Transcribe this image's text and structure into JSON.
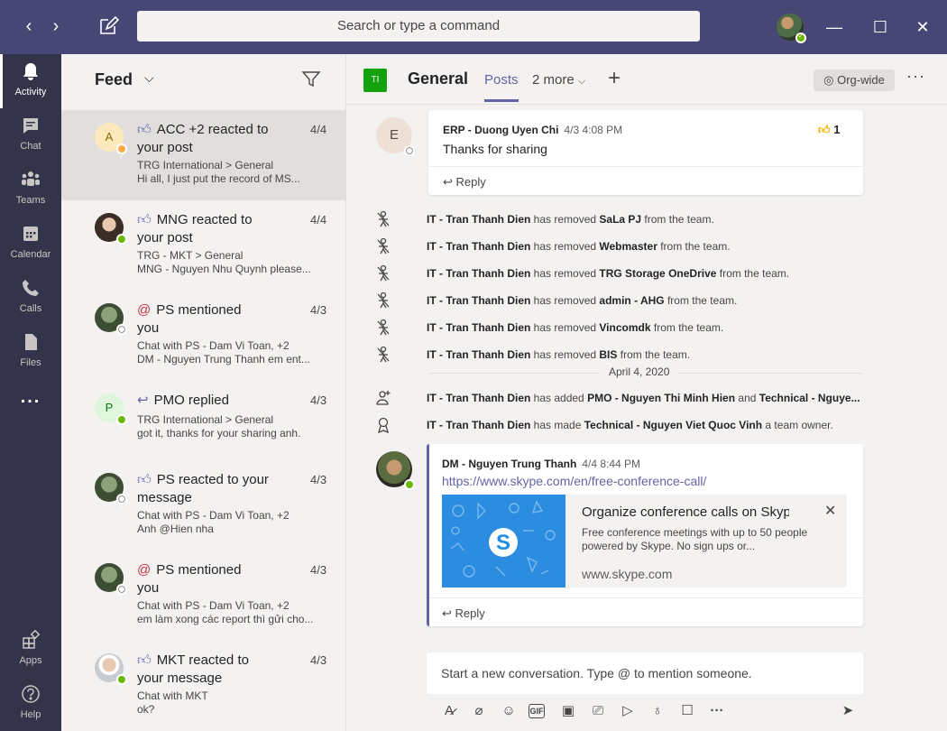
{
  "titlebar": {
    "search_placeholder": "Search or type a command",
    "back": "‹",
    "forward": "›",
    "minimize": "—",
    "maximize": "☐",
    "close": "✕"
  },
  "rail": {
    "items": [
      {
        "label": "Activity",
        "icon": "bell-icon"
      },
      {
        "label": "Chat",
        "icon": "chat-icon"
      },
      {
        "label": "Teams",
        "icon": "teams-icon"
      },
      {
        "label": "Calendar",
        "icon": "calendar-icon"
      },
      {
        "label": "Calls",
        "icon": "phone-icon"
      },
      {
        "label": "Files",
        "icon": "file-icon"
      },
      {
        "label": "...",
        "icon": "more-icon"
      }
    ],
    "apps_label": "Apps",
    "help_label": "Help"
  },
  "feed": {
    "title": "Feed",
    "items": [
      {
        "initial": "A",
        "line1": "ACC +2 reacted to",
        "line1b": "your post",
        "date": "4/4",
        "sub1": "TRG International > General",
        "sub2": "Hi all, I just put the record of MS..."
      },
      {
        "initial": "",
        "line1": "MNG reacted to",
        "line1b": "your post",
        "date": "4/4",
        "sub1": "TRG - MKT > General",
        "sub2": "MNG - Nguyen Nhu Quynh please..."
      },
      {
        "initial": "",
        "line1": "PS mentioned",
        "line1b": "you",
        "date": "4/3",
        "sub1": "Chat with PS - Dam Vi Toan, +2",
        "sub2": "DM - Nguyen Trung Thanh em ent..."
      },
      {
        "initial": "P",
        "line1": "PMO replied",
        "line1b": "",
        "date": "4/3",
        "sub1": "TRG International > General",
        "sub2": "got it, thanks for your sharing anh."
      },
      {
        "initial": "",
        "line1": "PS reacted to your",
        "line1b": "message",
        "date": "4/3",
        "sub1": "Chat with PS - Dam Vi Toan, +2",
        "sub2": "Anh @Hien nha"
      },
      {
        "initial": "",
        "line1": "PS mentioned",
        "line1b": "you",
        "date": "4/3",
        "sub1": "Chat with PS - Dam Vi Toan, +2",
        "sub2": "em làm xong các report thì gửi cho..."
      },
      {
        "initial": "",
        "line1": "MKT reacted to",
        "line1b": "your message",
        "date": "4/3",
        "sub1": "Chat with MKT",
        "sub2": "ok?"
      }
    ]
  },
  "channel": {
    "team_initials": "TI",
    "name": "General",
    "tab_posts": "Posts",
    "tab_more": "2 more",
    "org_wide": "Org-wide"
  },
  "messages": {
    "first": {
      "initial": "E",
      "author": "ERP - Duong Uyen Chi",
      "time": "4/3 4:08 PM",
      "text": "Thanks for sharing",
      "reaction_count": "1",
      "reply": "Reply"
    },
    "system_removed": [
      {
        "actor": "IT - Tran Thanh Dien",
        "verb": " has removed ",
        "target": "SaLa PJ",
        "rest": " from the team."
      },
      {
        "actor": "IT - Tran Thanh Dien",
        "verb": " has removed ",
        "target": "Webmaster",
        "rest": " from the team."
      },
      {
        "actor": "IT - Tran Thanh Dien",
        "verb": " has removed ",
        "target": "TRG Storage OneDrive",
        "rest": " from the team."
      },
      {
        "actor": "IT - Tran Thanh Dien",
        "verb": " has removed ",
        "target": "admin - AHG",
        "rest": " from the team."
      },
      {
        "actor": "IT - Tran Thanh Dien",
        "verb": " has removed ",
        "target": "Vincomdk",
        "rest": " from the team."
      },
      {
        "actor": "IT - Tran Thanh Dien",
        "verb": " has removed ",
        "target": "BIS",
        "rest": " from the team."
      }
    ],
    "date_separator": "April 4, 2020",
    "system_added": {
      "actor": "IT - Tran Thanh Dien",
      "verb": " has added ",
      "target": "PMO - Nguyen Thi Minh Hien",
      "mid": " and ",
      "target2": "Technical - Nguye..."
    },
    "system_owner": {
      "actor": "IT - Tran Thanh Dien",
      "verb": " has made ",
      "target": "Technical - Nguyen Viet Quoc Vinh",
      "rest": " a team owner."
    },
    "second": {
      "author": "DM - Nguyen Trung Thanh",
      "time": "4/4 8:44 PM",
      "link": "https://www.skype.com/en/free-conference-call/",
      "preview_title": "Organize conference calls on Skyp...",
      "preview_desc": "Free conference meetings with up to 50 people powered by Skype. No sign ups or...",
      "preview_url": "www.skype.com",
      "reply": "Reply"
    }
  },
  "compose": {
    "placeholder": "Start a new conversation. Type @ to mention someone."
  },
  "colors": {
    "titlebar": "#464775",
    "rail": "#33344a",
    "accent": "#6264a7",
    "presence": "#6bb700",
    "mention": "#c4314b",
    "team_tile": "#13a10e"
  }
}
